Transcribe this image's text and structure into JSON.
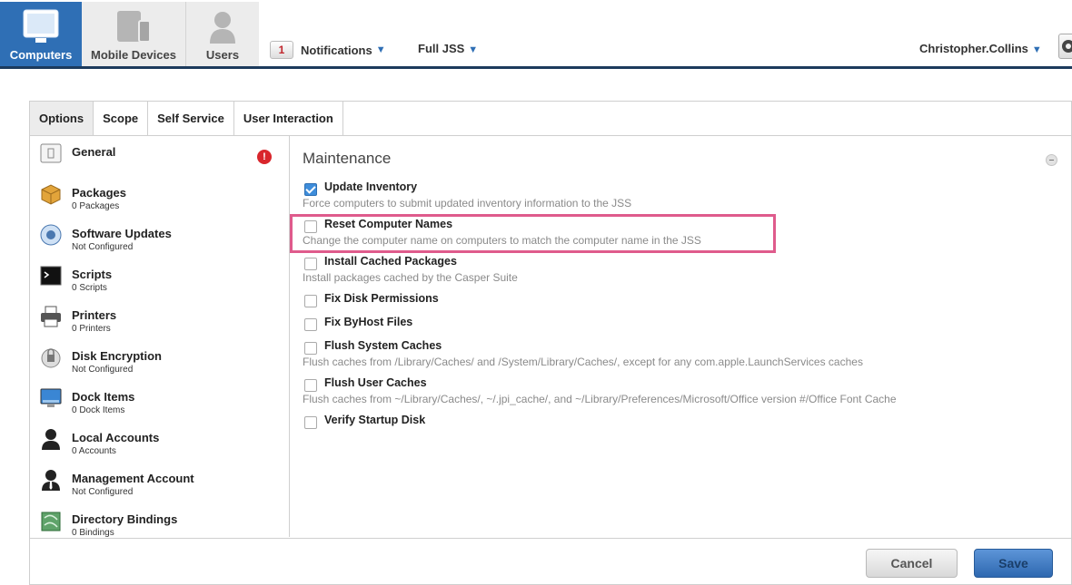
{
  "nav": {
    "tabs": [
      {
        "label": "Computers",
        "icon": "monitor-icon",
        "active": true
      },
      {
        "label": "Mobile Devices",
        "icon": "mobile-devices-icon",
        "active": false
      },
      {
        "label": "Users",
        "icon": "user-icon",
        "active": false
      }
    ],
    "notifications": {
      "count": "1",
      "label": "Notifications"
    },
    "site_selector": "Full JSS",
    "username": "Christopher.Collins"
  },
  "tabs": [
    {
      "label": "Options",
      "active": true
    },
    {
      "label": "Scope",
      "active": false
    },
    {
      "label": "Self Service",
      "active": false
    },
    {
      "label": "User Interaction",
      "active": false
    }
  ],
  "sidebar": {
    "items": [
      {
        "name": "General",
        "sub": "",
        "icon": "general-icon",
        "badge": "!"
      },
      {
        "name": "Packages",
        "sub": "0 Packages",
        "icon": "package-icon"
      },
      {
        "name": "Software Updates",
        "sub": "Not Configured",
        "icon": "software-update-icon"
      },
      {
        "name": "Scripts",
        "sub": "0 Scripts",
        "icon": "terminal-icon"
      },
      {
        "name": "Printers",
        "sub": "0 Printers",
        "icon": "printer-icon"
      },
      {
        "name": "Disk Encryption",
        "sub": "Not Configured",
        "icon": "disk-encryption-icon"
      },
      {
        "name": "Dock Items",
        "sub": "0 Dock Items",
        "icon": "dock-icon"
      },
      {
        "name": "Local Accounts",
        "sub": "0 Accounts",
        "icon": "account-icon"
      },
      {
        "name": "Management Account",
        "sub": "Not Configured",
        "icon": "management-account-icon"
      },
      {
        "name": "Directory Bindings",
        "sub": "0 Bindings",
        "icon": "directory-icon"
      }
    ]
  },
  "maintenance": {
    "title": "Maintenance",
    "options": [
      {
        "label": "Update Inventory",
        "desc": "Force computers to submit updated inventory information to the JSS",
        "checked": true
      },
      {
        "label": "Reset Computer Names",
        "desc": "Change the computer name on computers to match the computer name in the JSS",
        "checked": false
      },
      {
        "label": "Install Cached Packages",
        "desc": "Install packages cached by the Casper Suite",
        "checked": false
      },
      {
        "label": "Fix Disk Permissions",
        "desc": "",
        "checked": false
      },
      {
        "label": "Fix ByHost Files",
        "desc": "",
        "checked": false
      },
      {
        "label": "Flush System Caches",
        "desc": "Flush caches from /Library/Caches/ and /System/Library/Caches/, except for any com.apple.LaunchServices caches",
        "checked": false
      },
      {
        "label": "Flush User Caches",
        "desc": "Flush caches from ~/Library/Caches/, ~/.jpi_cache/, and ~/Library/Preferences/Microsoft/Office version #/Office Font Cache",
        "checked": false
      },
      {
        "label": "Verify Startup Disk",
        "desc": "",
        "checked": false
      }
    ]
  },
  "footer": {
    "cancel_label": "Cancel",
    "save_label": "Save"
  },
  "colors": {
    "accent": "#2f6fb5",
    "highlight": "#df5b8c",
    "error": "#d9262c"
  }
}
